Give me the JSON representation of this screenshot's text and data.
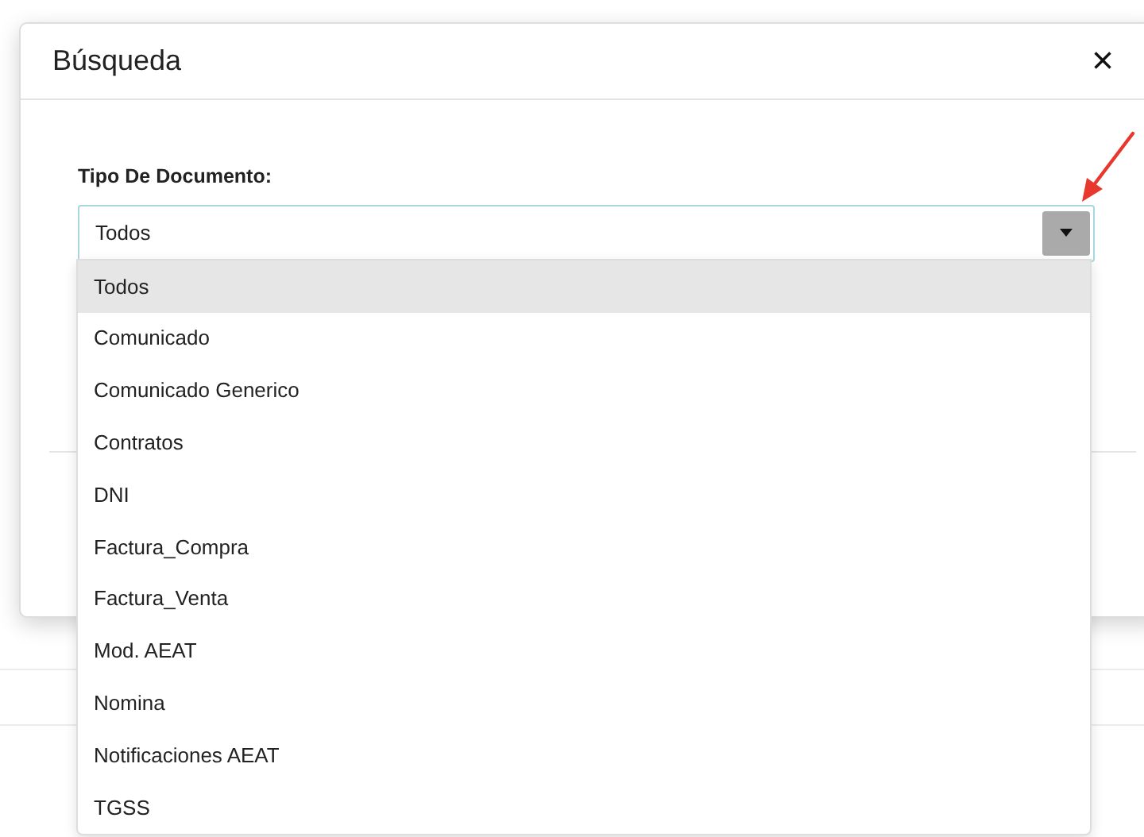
{
  "dialog": {
    "title": "Búsqueda",
    "close": "×"
  },
  "field": {
    "label": "Tipo De Documento:",
    "value": "Todos",
    "expanded": true
  },
  "options": [
    {
      "label": "Todos",
      "selected": true
    },
    {
      "label": "Comunicado",
      "selected": false
    },
    {
      "label": "Comunicado Generico",
      "selected": false
    },
    {
      "label": "Contratos",
      "selected": false
    },
    {
      "label": "DNI",
      "selected": false
    },
    {
      "label": "Factura_Compra",
      "selected": false
    },
    {
      "label": "Factura_Venta",
      "selected": false
    },
    {
      "label": "Mod. AEAT",
      "selected": false
    },
    {
      "label": "Nomina",
      "selected": false
    },
    {
      "label": "Notificaciones AEAT",
      "selected": false
    },
    {
      "label": "TGSS",
      "selected": false
    }
  ]
}
